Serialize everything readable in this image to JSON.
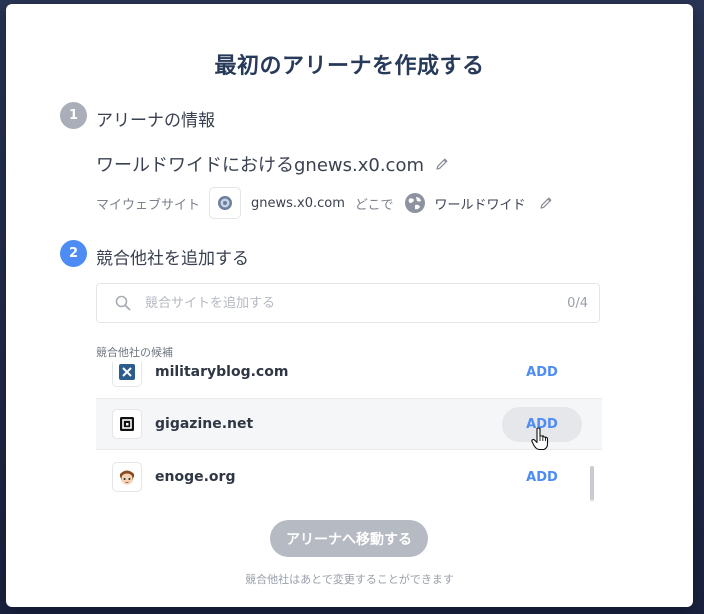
{
  "modal": {
    "title": "最初のアリーナを作成する",
    "step1": {
      "number": "1",
      "label": "アリーナの情報",
      "arena_name": "ワールドワイドにおけるgnews.x0.com",
      "my_website_label": "マイウェブサイト",
      "my_website": "gnews.x0.com",
      "where_label": "どこで",
      "region": "ワールドワイド"
    },
    "step2": {
      "number": "2",
      "label": "競合他社を追加する",
      "search": {
        "placeholder": "競合サイトを追加する",
        "value": "",
        "count": "0/4"
      },
      "candidates_label": "競合他社の候補",
      "candidates": [
        {
          "domain": "militaryblog.com",
          "add_label": "ADD",
          "icon": "x-logo-icon"
        },
        {
          "domain": "gigazine.net",
          "add_label": "ADD",
          "icon": "gigazine-logo-icon"
        },
        {
          "domain": "enoge.org",
          "add_label": "ADD",
          "icon": "enoge-mascot-icon"
        }
      ]
    },
    "go_button": "アリーナへ移動する",
    "footnote": "競合他社はあとで変更することができます"
  },
  "colors": {
    "accent": "#4d8cf5",
    "title": "#283a5a",
    "disabled_button": "#b5bac3",
    "step_inactive": "#a9aeb9"
  }
}
